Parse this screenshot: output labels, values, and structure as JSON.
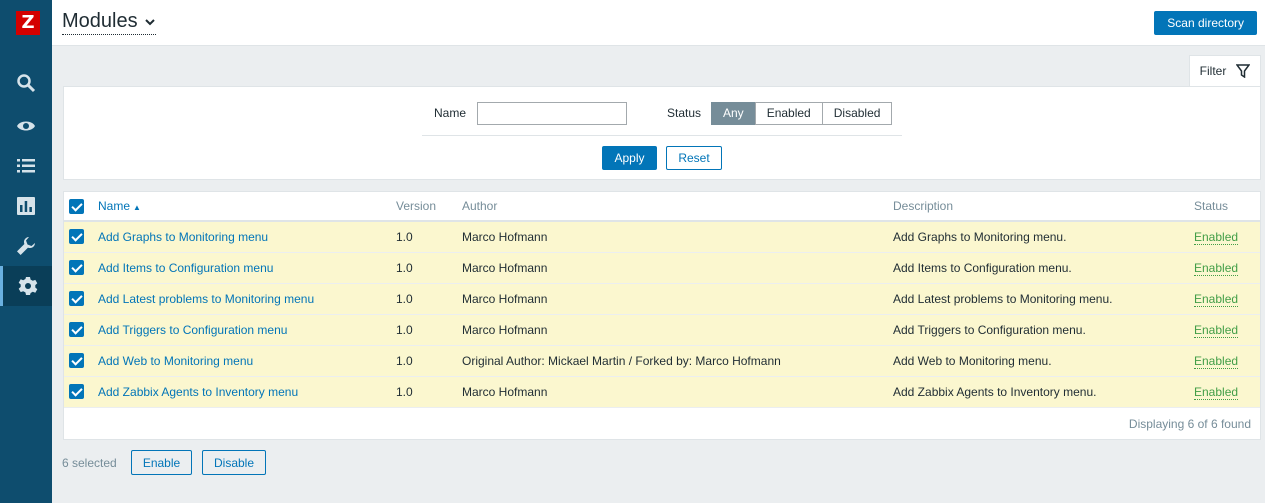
{
  "app": {
    "logo_letter": "Z",
    "brand_color": "#d40000",
    "sidebar_color": "#0e4d6e"
  },
  "sidebar": {
    "icons": [
      "search-icon",
      "eye-icon",
      "list-icon",
      "chart-icon",
      "wrench-icon",
      "gear-icon"
    ],
    "active": "gear-icon"
  },
  "header": {
    "title": "Modules",
    "scan_label": "Scan directory"
  },
  "filter": {
    "tab_label": "Filter",
    "name_label": "Name",
    "name_value": "",
    "status_label": "Status",
    "status_options": [
      "Any",
      "Enabled",
      "Disabled"
    ],
    "status_selected": "Any",
    "apply_label": "Apply",
    "reset_label": "Reset"
  },
  "table": {
    "columns": {
      "name": "Name",
      "version": "Version",
      "author": "Author",
      "description": "Description",
      "status": "Status"
    },
    "rows": [
      {
        "name": "Add Graphs to Monitoring menu",
        "version": "1.0",
        "author": "Marco Hofmann",
        "description": "Add Graphs to Monitoring menu.",
        "status": "Enabled"
      },
      {
        "name": "Add Items to Configuration menu",
        "version": "1.0",
        "author": "Marco Hofmann",
        "description": "Add Items to Configuration menu.",
        "status": "Enabled"
      },
      {
        "name": "Add Latest problems to Monitoring menu",
        "version": "1.0",
        "author": "Marco Hofmann",
        "description": "Add Latest problems to Monitoring menu.",
        "status": "Enabled"
      },
      {
        "name": "Add Triggers to Configuration menu",
        "version": "1.0",
        "author": "Marco Hofmann",
        "description": "Add Triggers to Configuration menu.",
        "status": "Enabled"
      },
      {
        "name": "Add Web to Monitoring menu",
        "version": "1.0",
        "author": "Original Author: Mickael Martin / Forked by: Marco Hofmann",
        "description": "Add Web to Monitoring menu.",
        "status": "Enabled"
      },
      {
        "name": "Add Zabbix Agents to Inventory menu",
        "version": "1.0",
        "author": "Marco Hofmann",
        "description": "Add Zabbix Agents to Inventory menu.",
        "status": "Enabled"
      }
    ],
    "footer": "Displaying 6 of 6 found"
  },
  "bottom": {
    "selected_text": "6 selected",
    "enable_label": "Enable",
    "disable_label": "Disable"
  }
}
